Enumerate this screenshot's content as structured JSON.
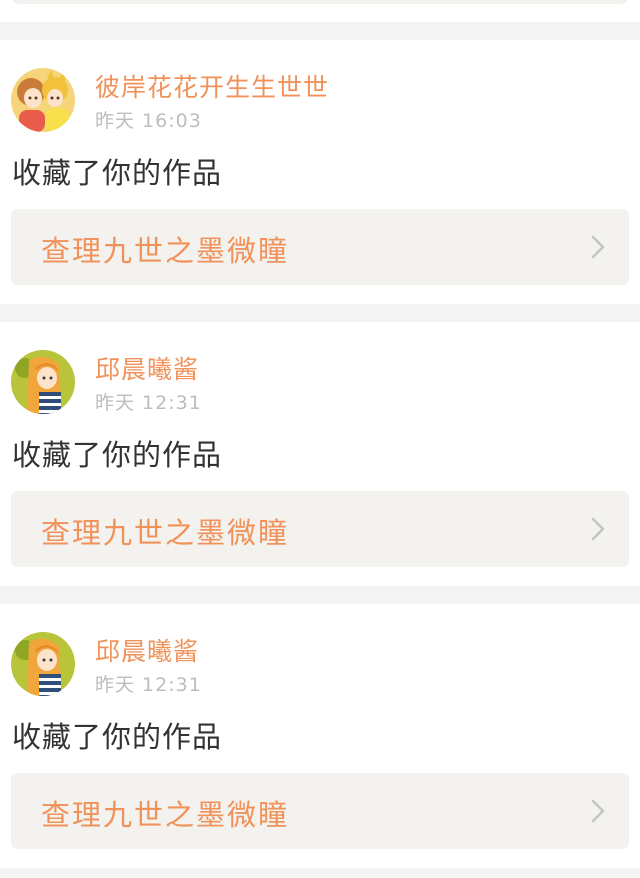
{
  "feed": {
    "items": [
      {
        "username": "彼岸花花开生生世世",
        "timestamp": "昨天 16:03",
        "action": "收藏了你的作品",
        "work_title": "查理九世之墨微瞳",
        "avatar_icon": "avatar-anime-girls-icon",
        "chevron_icon": "chevron-right-icon"
      },
      {
        "username": "邱晨曦酱",
        "timestamp": "昨天 12:31",
        "action": "收藏了你的作品",
        "work_title": "查理九世之墨微瞳",
        "avatar_icon": "avatar-anime-girl-icon",
        "chevron_icon": "chevron-right-icon"
      },
      {
        "username": "邱晨曦酱",
        "timestamp": "昨天 12:31",
        "action": "收藏了你的作品",
        "work_title": "查理九世之墨微瞳",
        "avatar_icon": "avatar-anime-girl-icon",
        "chevron_icon": "chevron-right-icon"
      }
    ]
  },
  "colors": {
    "accent": "#f0925a",
    "timestamp": "#bdbdbd",
    "body_text": "#333333",
    "link_background": "#f3f2ee",
    "page_background": "#f4f4f4"
  }
}
